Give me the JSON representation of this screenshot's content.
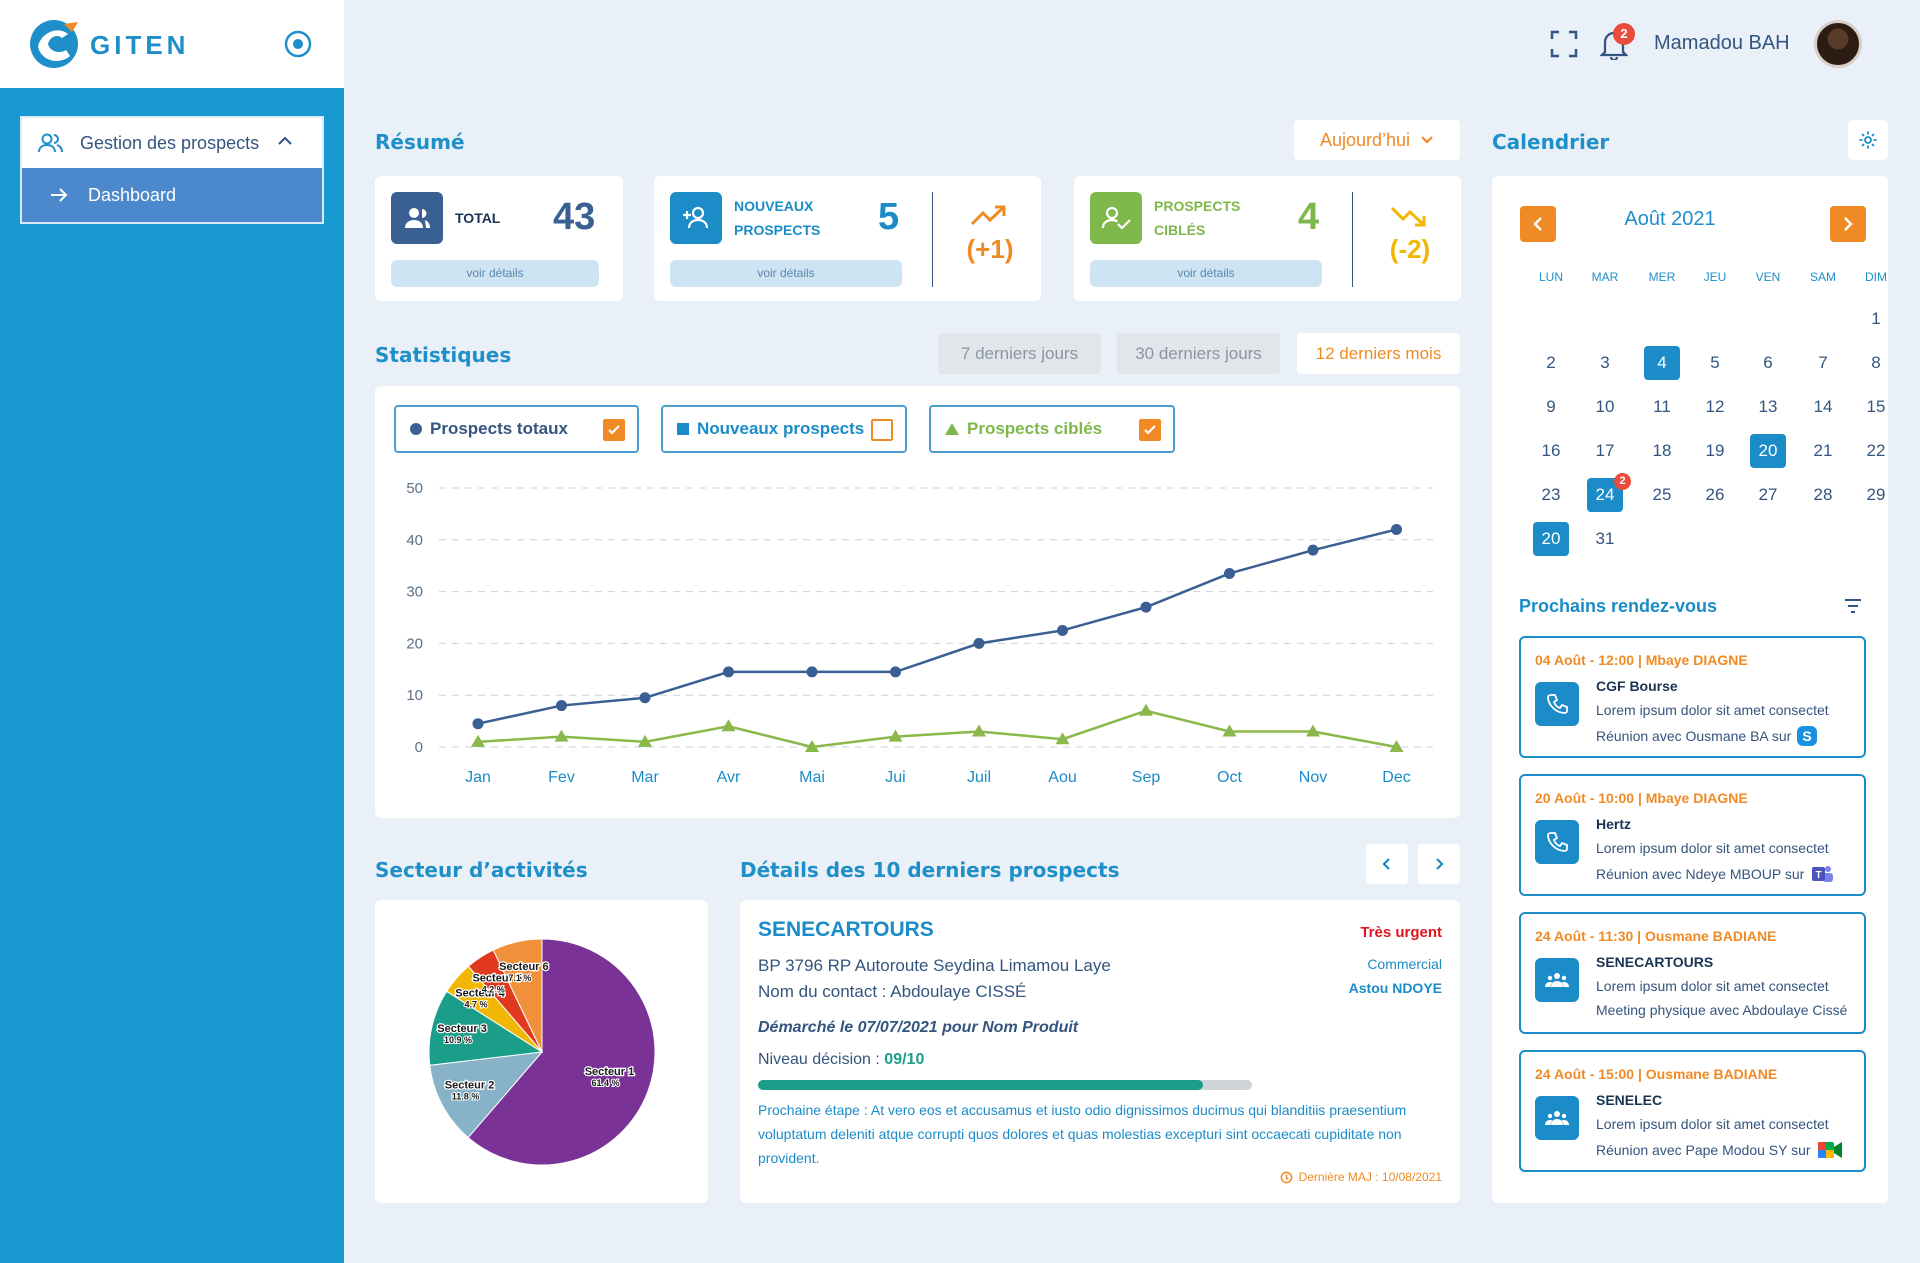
{
  "app": {
    "logo_text": "GITEN"
  },
  "sidebar": {
    "group_label": "Gestion des prospects",
    "items": [
      {
        "label": "Dashboard"
      }
    ]
  },
  "header": {
    "notifications_count": "2",
    "user_name": "Mamadou BAH"
  },
  "resume": {
    "title": "Résumé",
    "period": "Aujourd’hui",
    "cards": [
      {
        "label": "TOTAL",
        "value": "43",
        "details": "voir détails",
        "color": "#3a5f93"
      },
      {
        "label_line1": "NOUVEAUX",
        "label_line2": "PROSPECTS",
        "value": "5",
        "delta": "(+1)",
        "details": "voir détails",
        "color": "#1b8cc7"
      },
      {
        "label_line1": "PROSPECTS",
        "label_line2": "CIBLÉS",
        "value": "4",
        "delta": "(-2)",
        "details": "voir détails",
        "color": "#7fb84a"
      }
    ]
  },
  "stats": {
    "title": "Statistiques",
    "ranges": [
      "7 derniers jours",
      "30 derniers jours",
      "12 derniers mois"
    ],
    "active_range": "12 derniers mois",
    "legend": [
      {
        "label": "Prospects totaux",
        "checked": true
      },
      {
        "label": "Nouveaux prospects",
        "checked": false
      },
      {
        "label": "Prospects ciblés",
        "checked": true
      }
    ]
  },
  "chart_data": [
    {
      "type": "line",
      "x": [
        "Jan",
        "Fev",
        "Mar",
        "Avr",
        "Mai",
        "Jui",
        "Juil",
        "Aou",
        "Sep",
        "Oct",
        "Nov",
        "Dec"
      ],
      "ylim": [
        0,
        50
      ],
      "yticks": [
        0,
        10,
        20,
        30,
        40,
        50
      ],
      "grid": true,
      "series": [
        {
          "name": "Prospects totaux",
          "color": "#3a5f93",
          "marker": "circle",
          "values": [
            4.5,
            8,
            9.5,
            14.5,
            14.5,
            14.5,
            20,
            22.5,
            27,
            33.5,
            38,
            42
          ]
        },
        {
          "name": "Prospects ciblés",
          "color": "#8ab84a",
          "marker": "triangle",
          "values": [
            1,
            2,
            1,
            4,
            0,
            2,
            3,
            1.5,
            7,
            3,
            3,
            0
          ]
        }
      ]
    },
    {
      "type": "pie",
      "slices": [
        {
          "label": "Secteur 1",
          "value": 61.4,
          "display": "61.4 %",
          "color": "#7b3297"
        },
        {
          "label": "Secteur 2",
          "value": 11.8,
          "display": "11.8 %",
          "color": "#87b2c8"
        },
        {
          "label": "Secteur 3",
          "value": 10.9,
          "display": "10.9 %",
          "color": "#1a9e8a"
        },
        {
          "label": "Secteur 4",
          "value": 4.7,
          "display": "4.7 %",
          "color": "#f2b705"
        },
        {
          "label": "Secteur 5",
          "value": 4.2,
          "display": "4.2 %",
          "color": "#e0391e"
        },
        {
          "label": "Secteur 6",
          "value": 7.1,
          "display": "7.1 %",
          "color": "#f0903a"
        }
      ]
    }
  ],
  "secteur": {
    "title": "Secteur d’activités"
  },
  "details": {
    "title": "Détails des 10 derniers prospects",
    "company": "SENECARTOURS",
    "urgency": "Très urgent",
    "address": "BP 3796 RP Autoroute Seydina Limamou Laye",
    "contact": "Nom du contact : Abdoulaye CISSÉ",
    "role": "Commercial",
    "owner": "Astou NDOYE",
    "demarche": "Démarché le 07/07/2021 pour Nom Produit",
    "niveau_label": "Niveau décision : ",
    "niveau_value": "09/10",
    "niveau_fraction": 0.9,
    "prochaine_etape": "Prochaine étape : At vero eos et accusamus et iusto odio dignissimos ducimus qui blanditiis praesentium voluptatum deleniti atque corrupti quos dolores et quas molestias excepturi sint occaecati cupiditate non provident.",
    "last_update": "Dernière MAJ : 10/08/2021"
  },
  "calendar": {
    "title": "Calendrier",
    "month": "Août 2021",
    "days_of_week": [
      "LUN",
      "MAR",
      "MER",
      "JEU",
      "VEN",
      "SAM",
      "DIM"
    ],
    "weeks": [
      [
        "",
        "",
        "",
        "",
        "",
        "",
        "1"
      ],
      [
        "2",
        "3",
        "4",
        "5",
        "6",
        "7",
        "8"
      ],
      [
        "9",
        "10",
        "11",
        "12",
        "13",
        "14",
        "15"
      ],
      [
        "16",
        "17",
        "18",
        "19",
        "20",
        "21",
        "22"
      ],
      [
        "23",
        "24",
        "25",
        "26",
        "27",
        "28",
        "29"
      ],
      [
        "20",
        "31",
        "",
        "",
        "",
        "",
        ""
      ]
    ],
    "selected": [
      "4",
      "20",
      "24"
    ],
    "badge_day": "24",
    "badge_count": "2"
  },
  "rdv": {
    "title": "Prochains rendez-vous",
    "items": [
      {
        "date": "04 Août - 12:00 | Mbaye DIAGNE",
        "title": "CGF Bourse",
        "desc": "Lorem ipsum dolor sit amet consectet",
        "meet": "Réunion avec Ousmane BA sur",
        "icon": "phone-icon",
        "app": "skype-icon"
      },
      {
        "date": "20 Août - 10:00 | Mbaye DIAGNE",
        "title": "Hertz",
        "desc": "Lorem ipsum dolor sit amet consectet",
        "meet": "Réunion avec Ndeye MBOUP sur",
        "icon": "phone-icon",
        "app": "teams-icon"
      },
      {
        "date": "24 Août - 11:30 | Ousmane BADIANE",
        "title": "SENECARTOURS",
        "desc": "Lorem ipsum dolor sit amet consectet",
        "meet": "Meeting physique avec Abdoulaye Cissé",
        "icon": "people-icon",
        "app": ""
      },
      {
        "date": "24 Août - 15:00 | Ousmane BADIANE",
        "title": "SENELEC",
        "desc": "Lorem ipsum dolor sit amet consectet",
        "meet": "Réunion avec Pape Modou SY sur",
        "icon": "people-icon",
        "app": "meet-icon"
      }
    ]
  }
}
